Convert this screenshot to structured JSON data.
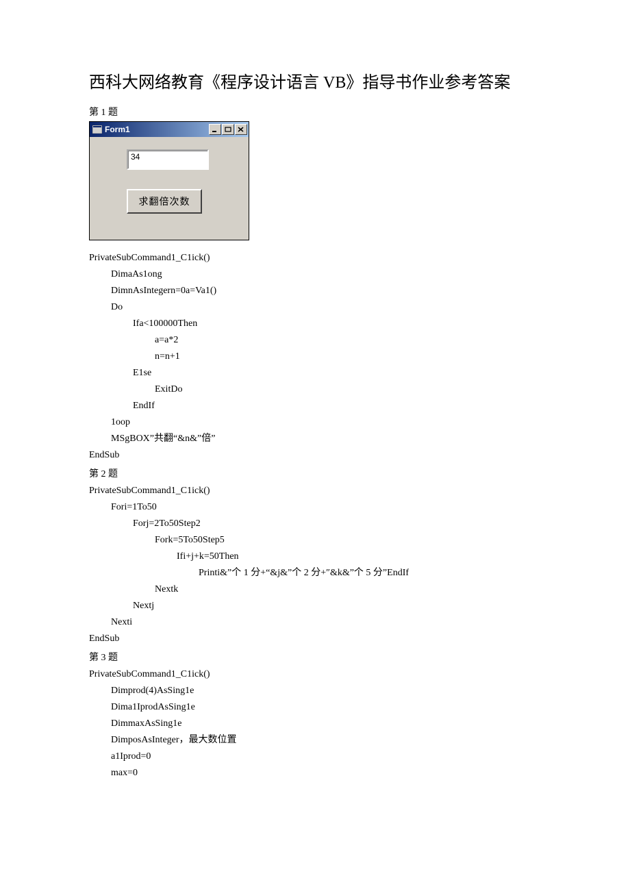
{
  "title": "西科大网络教育《程序设计语言 VB》指导书作业参考答案",
  "q1_label": "第 1 题",
  "q2_label": "第 2 题",
  "q3_label": "第 3 题",
  "form1": {
    "title": "Form1",
    "textbox_value": "34",
    "button_label": "求翻倍次数"
  },
  "code1": {
    "l0": "PrivateSubCommand1_C1ick()",
    "l1": "DimaAs1ong",
    "l2": "DimnAsIntegern=0a=Va1()",
    "l3": "Do",
    "l4": "Ifa<100000Then",
    "l5": "a=a*2",
    "l6": "n=n+1",
    "l7": "E1se",
    "l8": "ExitDo",
    "l9": "EndIf",
    "l10": "1oop",
    "l11": "MSgBOX”共翻“&n&”倍”",
    "l12": "EndSub"
  },
  "code2": {
    "l0": "PrivateSubCommand1_C1ick()",
    "l1": "Fori=1To50",
    "l2": "Forj=2To50Step2",
    "l3": "Fork=5To50Step5",
    "l4": "Ifi+j+k=50Then",
    "l5": "Printi&”个 1 分+“&j&”个 2 分+″&k&”个 5 分”EndIf",
    "l6": "Nextk",
    "l7": "Nextj",
    "l8": "Nexti",
    "l9": "EndSub"
  },
  "code3": {
    "l0": "PrivateSubCommand1_C1ick()",
    "l1": "Dimprod(4)AsSing1e",
    "l2": "Dima1IprodAsSing1e",
    "l3": "DimmaxAsSing1e",
    "l4": "DimposAsInteger，最大数位置",
    "l5": "a1Iprod=0",
    "l6": "max=0"
  }
}
